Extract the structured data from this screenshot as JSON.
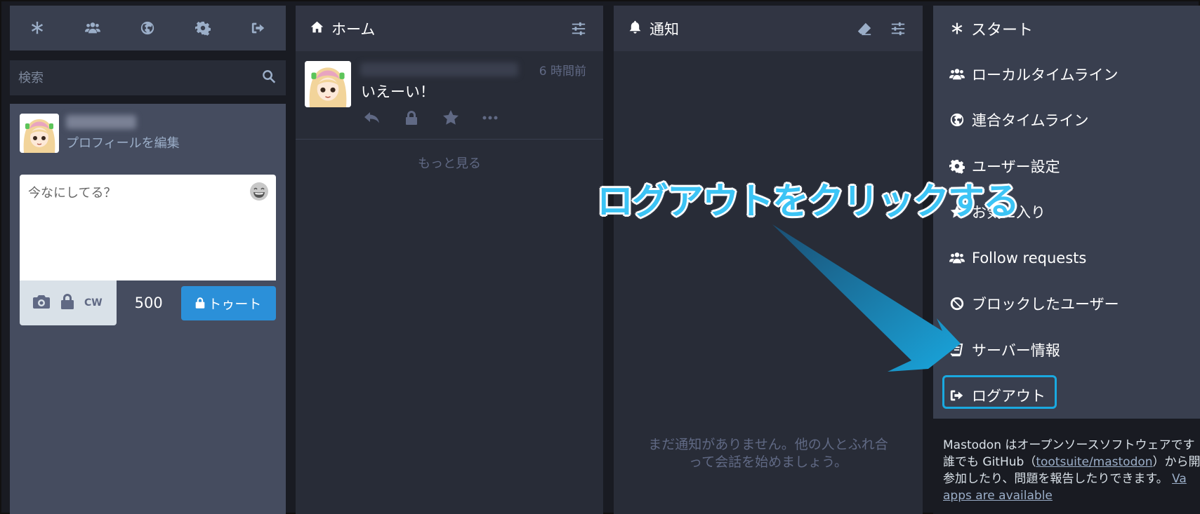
{
  "drawer": {
    "tabs": [
      {
        "name": "getting-started-tab",
        "icon": "asterisk-icon"
      },
      {
        "name": "local-timeline-tab",
        "icon": "users-icon"
      },
      {
        "name": "federated-timeline-tab",
        "icon": "globe-icon"
      },
      {
        "name": "preferences-tab",
        "icon": "gear-icon"
      },
      {
        "name": "logout-tab",
        "icon": "sign-out-icon"
      }
    ],
    "search_placeholder": "検索",
    "edit_profile": "プロフィールを編集",
    "compose_placeholder": "今なにしてる？",
    "cw_label": "CW",
    "char_count": "500",
    "toot_label": "トゥート"
  },
  "home": {
    "title": "ホーム",
    "status": {
      "time": "6 時間前",
      "content": "いえーい！"
    },
    "load_more": "もっと見る"
  },
  "notifications": {
    "title": "通知",
    "empty_line1": "まだ通知がありません。他の人とふれ合",
    "empty_line2": "って会話を始めましょう。"
  },
  "start": {
    "title": "スタート",
    "items": [
      {
        "label": "ローカルタイムライン",
        "icon": "users-icon"
      },
      {
        "label": "連合タイムライン",
        "icon": "globe-icon"
      },
      {
        "label": "ユーザー設定",
        "icon": "gear-icon"
      },
      {
        "label": "お気に入り",
        "icon": "star-icon"
      },
      {
        "label": "Follow requests",
        "icon": "users-icon"
      },
      {
        "label": "ブロックしたユーザー",
        "icon": "ban-icon"
      },
      {
        "label": "サーバー情報",
        "icon": "book-icon"
      },
      {
        "label": "ログアウト",
        "icon": "sign-out-icon"
      }
    ],
    "about": {
      "line1": "Mastodon はオープンソースソフトウェアです",
      "line2_a": "誰でも GitHub（",
      "line2_link": "tootsuite/mastodon",
      "line2_b": "）から開発",
      "line3_a": "参加したり、問題を報告したりできます。",
      "line3_link": "Va",
      "line4_link": "apps are available"
    }
  },
  "annotation": {
    "text": "ログアウトをクリックする",
    "color": "#3cc4f5"
  },
  "colors": {
    "accent": "#2b90d9",
    "highlight": "#1aa9e0"
  }
}
